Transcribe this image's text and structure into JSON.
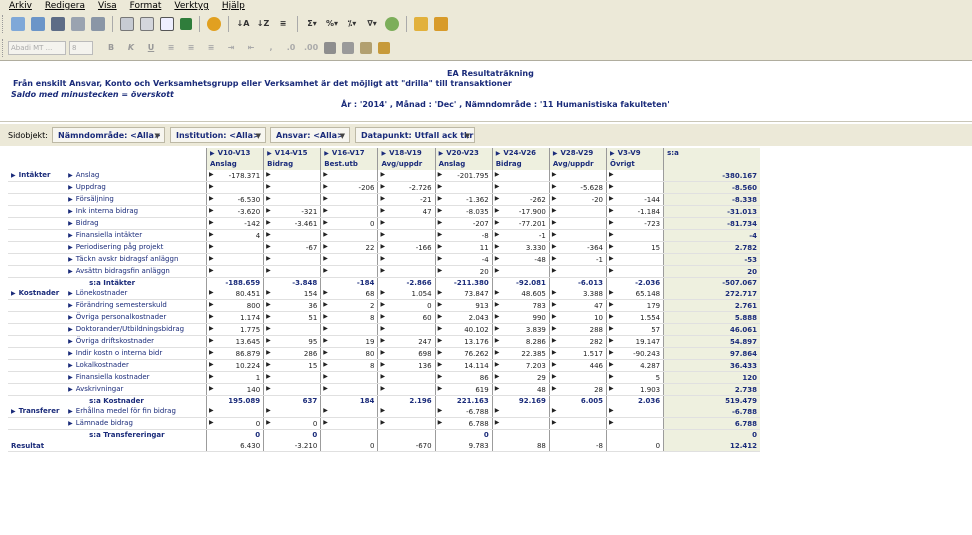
{
  "menu": [
    "Arkiv",
    "Redigera",
    "Visa",
    "Format",
    "Verktyg",
    "Hjälp"
  ],
  "format_bar": {
    "font": "Abadi MT ...",
    "size": "8"
  },
  "header": {
    "title": "EA Resultaträkning",
    "description": "Från enskilt Ansvar, Konto och Verksamhetsgrupp eller Verksamhet är det möjligt att \"drilla\" till transaktioner",
    "note": "Saldo med minustecken = överskott",
    "filter": "År : '2014' , Månad : 'Dec' , Nämndområde : '11 Humanistiska fakulteten'"
  },
  "side": {
    "label": "Sidobjekt:",
    "dropdowns": [
      "Nämndområde: <Alla>",
      "Institution: <Alla>",
      "Ansvar: <Alla>",
      "Datapunkt: Utfall ack tkr"
    ]
  },
  "columns": [
    {
      "code": "V10-V13",
      "name": "Anslag"
    },
    {
      "code": "V14-V15",
      "name": "Bidrag"
    },
    {
      "code": "V16-V17",
      "name": "Best.utb"
    },
    {
      "code": "V18-V19",
      "name": "Avg/uppdr"
    },
    {
      "code": "V20-V23",
      "name": "Anslag"
    },
    {
      "code": "V24-V26",
      "name": "Bidrag"
    },
    {
      "code": "V28-V29",
      "name": "Avg/uppdr"
    },
    {
      "code": "V3-V9",
      "name": "Övrigt"
    }
  ],
  "total_header": "s:a",
  "rows": [
    {
      "group": "Intäkter",
      "label": "Anslag",
      "v": [
        "-178.371",
        "",
        "",
        "",
        "-201.795",
        "",
        "",
        ""
      ],
      "total": "-380.167",
      "m": [
        1,
        1,
        1,
        1,
        1,
        1,
        1,
        1
      ]
    },
    {
      "group": "",
      "label": "Uppdrag",
      "v": [
        "",
        "",
        "-206",
        "-2.726",
        "",
        "",
        "-5.628",
        ""
      ],
      "total": "-8.560",
      "m": [
        1,
        1,
        1,
        1,
        1,
        1,
        1,
        1
      ]
    },
    {
      "group": "",
      "label": "Försäljning",
      "v": [
        "-6.530",
        "",
        "",
        "-21",
        "-1.362",
        "-262",
        "-20",
        "-144"
      ],
      "total": "-8.338",
      "m": [
        1,
        1,
        1,
        1,
        1,
        1,
        1,
        1
      ]
    },
    {
      "group": "",
      "label": "Ink interna bidrag",
      "v": [
        "-3.620",
        "-321",
        "",
        "47",
        "-8.035",
        "-17.900",
        "",
        "-1.184"
      ],
      "total": "-31.013",
      "m": [
        1,
        1,
        1,
        1,
        1,
        1,
        1,
        1
      ]
    },
    {
      "group": "",
      "label": "Bidrag",
      "v": [
        "-142",
        "-3.461",
        "0",
        "",
        "-207",
        "-77.201",
        "",
        "-723"
      ],
      "total": "-81.734",
      "m": [
        1,
        1,
        1,
        1,
        1,
        1,
        1,
        1
      ]
    },
    {
      "group": "",
      "label": "Finansiella intäkter",
      "v": [
        "4",
        "",
        "",
        "",
        "-8",
        "-1",
        "",
        ""
      ],
      "total": "-4",
      "m": [
        1,
        1,
        1,
        1,
        1,
        1,
        1,
        1
      ]
    },
    {
      "group": "",
      "label": "Periodisering påg projekt",
      "v": [
        "",
        "-67",
        "22",
        "-166",
        "11",
        "3.330",
        "-364",
        "15"
      ],
      "total": "2.782",
      "m": [
        1,
        1,
        1,
        1,
        1,
        1,
        1,
        1
      ]
    },
    {
      "group": "",
      "label": "Täckn avskr bidragsf anläggn",
      "v": [
        "",
        "",
        "",
        "",
        "-4",
        "-48",
        "-1",
        ""
      ],
      "total": "-53",
      "m": [
        1,
        1,
        1,
        1,
        1,
        1,
        1,
        1
      ]
    },
    {
      "group": "",
      "label": "Avsättn bidragsfin anläggn",
      "v": [
        "",
        "",
        "",
        "",
        "20",
        "",
        "",
        ""
      ],
      "total": "20",
      "m": [
        1,
        1,
        1,
        1,
        1,
        1,
        1,
        1
      ]
    },
    {
      "group": "",
      "label": "s:a Intäkter",
      "sum": true,
      "v": [
        "-188.659",
        "-3.848",
        "-184",
        "-2.866",
        "-211.380",
        "-92.081",
        "-6.013",
        "-2.036"
      ],
      "total": "-507.067"
    },
    {
      "group": "Kostnader",
      "label": "Lönekostnader",
      "v": [
        "80.451",
        "154",
        "68",
        "1.054",
        "73.847",
        "48.605",
        "3.388",
        "65.148"
      ],
      "total": "272.717",
      "m": [
        1,
        1,
        1,
        1,
        1,
        1,
        1,
        1
      ]
    },
    {
      "group": "",
      "label": "Förändring semesterskuld",
      "v": [
        "800",
        "36",
        "2",
        "0",
        "913",
        "783",
        "47",
        "179"
      ],
      "total": "2.761",
      "m": [
        1,
        1,
        1,
        1,
        1,
        1,
        1,
        1
      ]
    },
    {
      "group": "",
      "label": "Övriga personalkostnader",
      "v": [
        "1.174",
        "51",
        "8",
        "60",
        "2.043",
        "990",
        "10",
        "1.554"
      ],
      "total": "5.888",
      "m": [
        1,
        1,
        1,
        1,
        1,
        1,
        1,
        1
      ]
    },
    {
      "group": "",
      "label": "Doktorander/Utbildningsbidrag",
      "v": [
        "1.775",
        "",
        "",
        "",
        "40.102",
        "3.839",
        "288",
        "57"
      ],
      "total": "46.061",
      "m": [
        1,
        1,
        1,
        1,
        1,
        1,
        1,
        1
      ]
    },
    {
      "group": "",
      "label": "Övriga driftskostnader",
      "v": [
        "13.645",
        "95",
        "19",
        "247",
        "13.176",
        "8.286",
        "282",
        "19.147"
      ],
      "total": "54.897",
      "m": [
        1,
        1,
        1,
        1,
        1,
        1,
        1,
        1
      ]
    },
    {
      "group": "",
      "label": "Indir kostn o interna bidr",
      "v": [
        "86.879",
        "286",
        "80",
        "698",
        "76.262",
        "22.385",
        "1.517",
        "-90.243"
      ],
      "total": "97.864",
      "m": [
        1,
        1,
        1,
        1,
        1,
        1,
        1,
        1
      ]
    },
    {
      "group": "",
      "label": "Lokalkostnader",
      "v": [
        "10.224",
        "15",
        "8",
        "136",
        "14.114",
        "7.203",
        "446",
        "4.287"
      ],
      "total": "36.433",
      "m": [
        1,
        1,
        1,
        1,
        1,
        1,
        1,
        1
      ]
    },
    {
      "group": "",
      "label": "Finansiella kostnader",
      "v": [
        "1",
        "",
        "",
        "",
        "86",
        "29",
        "",
        "5"
      ],
      "total": "120",
      "m": [
        1,
        1,
        1,
        1,
        1,
        1,
        1,
        1
      ]
    },
    {
      "group": "",
      "label": "Avskrivningar",
      "v": [
        "140",
        "",
        "",
        "",
        "619",
        "48",
        "28",
        "1.903"
      ],
      "total": "2.738",
      "m": [
        1,
        1,
        1,
        1,
        1,
        1,
        1,
        1
      ]
    },
    {
      "group": "",
      "label": "s:a Kostnader",
      "sum": true,
      "v": [
        "195.089",
        "637",
        "184",
        "2.196",
        "221.163",
        "92.169",
        "6.005",
        "2.036"
      ],
      "total": "519.479"
    },
    {
      "group": "Transferer",
      "label": "Erhållna medel för fin bidrag",
      "v": [
        "",
        "",
        "",
        "",
        "-6.788",
        "",
        "",
        ""
      ],
      "total": "-6.788",
      "m": [
        1,
        1,
        1,
        1,
        1,
        1,
        1,
        1
      ]
    },
    {
      "group": "",
      "label": "Lämnade bidrag",
      "v": [
        "0",
        "0",
        "",
        "",
        "6.788",
        "",
        "",
        ""
      ],
      "total": "6.788",
      "m": [
        1,
        1,
        1,
        1,
        1,
        1,
        1,
        1
      ]
    },
    {
      "group": "",
      "label": "s:a Transfereringar",
      "sum": true,
      "v": [
        "0",
        "0",
        "",
        "",
        "0",
        "",
        "",
        ""
      ],
      "total": "0"
    },
    {
      "group": "Resultat",
      "label": "",
      "result": true,
      "v": [
        "6.430",
        "-3.210",
        "0",
        "-670",
        "9.783",
        "88",
        "-8",
        "0"
      ],
      "total": "12.412"
    }
  ]
}
